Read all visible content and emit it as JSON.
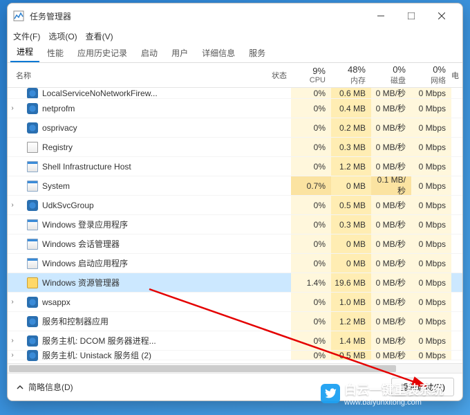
{
  "window": {
    "title": "任务管理器"
  },
  "menus": {
    "file": "文件(F)",
    "options": "选项(O)",
    "view": "查看(V)"
  },
  "tabs": {
    "processes": "进程",
    "performance": "性能",
    "app_history": "应用历史记录",
    "startup": "启动",
    "users": "用户",
    "details": "详细信息",
    "services": "服务"
  },
  "columns": {
    "name": "名称",
    "status": "状态",
    "cpu": {
      "pct": "9%",
      "label": "CPU"
    },
    "memory": {
      "pct": "48%",
      "label": "内存"
    },
    "disk": {
      "pct": "0%",
      "label": "磁盘"
    },
    "network": {
      "pct": "0%",
      "label": "网络"
    },
    "power": "电"
  },
  "rows": [
    {
      "expand": false,
      "icon": "gear",
      "name": "LocalServiceNoNetworkFirew...",
      "cpu": "0%",
      "mem": "0.6 MB",
      "disk": "0 MB/秒",
      "net": "0 Mbps",
      "partial": true
    },
    {
      "expand": true,
      "icon": "gear",
      "name": "netprofm",
      "cpu": "0%",
      "mem": "0.4 MB",
      "disk": "0 MB/秒",
      "net": "0 Mbps"
    },
    {
      "expand": false,
      "icon": "gear",
      "name": "osprivacy",
      "cpu": "0%",
      "mem": "0.2 MB",
      "disk": "0 MB/秒",
      "net": "0 Mbps"
    },
    {
      "expand": false,
      "icon": "file",
      "name": "Registry",
      "cpu": "0%",
      "mem": "0.3 MB",
      "disk": "0 MB/秒",
      "net": "0 Mbps"
    },
    {
      "expand": false,
      "icon": "win",
      "name": "Shell Infrastructure Host",
      "cpu": "0%",
      "mem": "1.2 MB",
      "disk": "0 MB/秒",
      "net": "0 Mbps"
    },
    {
      "expand": false,
      "icon": "win",
      "name": "System",
      "cpu": "0.7%",
      "mem": "0 MB",
      "disk": "0.1 MB/秒",
      "net": "0 Mbps",
      "cpu_hl": true,
      "disk_hl": true
    },
    {
      "expand": true,
      "icon": "gear",
      "name": "UdkSvcGroup",
      "cpu": "0%",
      "mem": "0.5 MB",
      "disk": "0 MB/秒",
      "net": "0 Mbps"
    },
    {
      "expand": false,
      "icon": "win",
      "name": "Windows 登录应用程序",
      "cpu": "0%",
      "mem": "0.3 MB",
      "disk": "0 MB/秒",
      "net": "0 Mbps"
    },
    {
      "expand": false,
      "icon": "win",
      "name": "Windows 会话管理器",
      "cpu": "0%",
      "mem": "0 MB",
      "disk": "0 MB/秒",
      "net": "0 Mbps"
    },
    {
      "expand": false,
      "icon": "win",
      "name": "Windows 启动应用程序",
      "cpu": "0%",
      "mem": "0 MB",
      "disk": "0 MB/秒",
      "net": "0 Mbps"
    },
    {
      "expand": false,
      "icon": "folder",
      "name": "Windows 资源管理器",
      "cpu": "1.4%",
      "mem": "19.6 MB",
      "disk": "0 MB/秒",
      "net": "0 Mbps",
      "selected": true
    },
    {
      "expand": true,
      "icon": "gear",
      "name": "wsappx",
      "cpu": "0%",
      "mem": "1.0 MB",
      "disk": "0 MB/秒",
      "net": "0 Mbps"
    },
    {
      "expand": false,
      "icon": "gear",
      "name": "服务和控制器应用",
      "cpu": "0%",
      "mem": "1.2 MB",
      "disk": "0 MB/秒",
      "net": "0 Mbps"
    },
    {
      "expand": true,
      "icon": "gear",
      "name": "服务主机: DCOM 服务器进程...",
      "cpu": "0%",
      "mem": "1.4 MB",
      "disk": "0 MB/秒",
      "net": "0 Mbps"
    },
    {
      "expand": true,
      "icon": "gear",
      "name": "服务主机: Unistack 服务组 (2)",
      "cpu": "0%",
      "mem": "0.5 MB",
      "disk": "0 MB/秒",
      "net": "0 Mbps",
      "partial_bottom": true
    }
  ],
  "footer": {
    "fewer": "简略信息(D)",
    "action": "重新启动(R)"
  },
  "watermark": {
    "text": "白云一键重装系统",
    "url": "www.baiyunxitong.com"
  }
}
